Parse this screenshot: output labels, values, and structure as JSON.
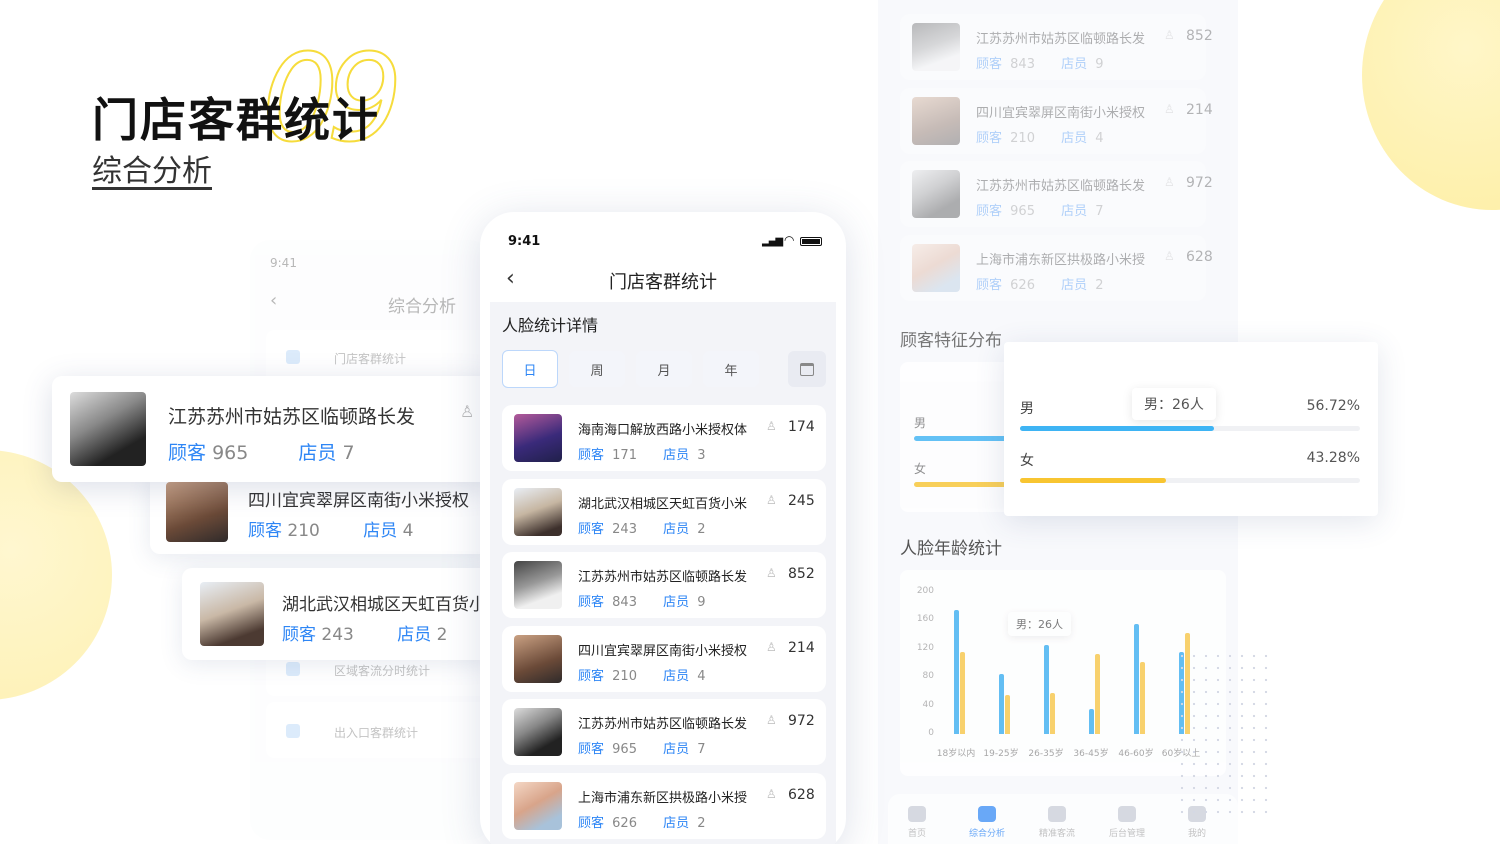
{
  "hero": {
    "title": "门店客群统计",
    "subtitle": "综合分析",
    "number": "09"
  },
  "left_phone": {
    "time": "9:41",
    "title": "综合分析",
    "menu": [
      "门店客群统计",
      "区域客流分时统计",
      "出入口客群统计"
    ]
  },
  "float_cards": [
    {
      "name": "江苏苏州市姑苏区临顿路长发",
      "customers_label": "顾客",
      "customers": "965",
      "staff_label": "店员",
      "staff": "7"
    },
    {
      "name": "四川宜宾翠屏区南街小米授权",
      "customers_label": "顾客",
      "customers": "210",
      "staff_label": "店员",
      "staff": "4"
    },
    {
      "name": "湖北武汉相城区天虹百货小",
      "customers_label": "顾客",
      "customers": "243",
      "staff_label": "店员",
      "staff": "2"
    }
  ],
  "phone": {
    "time": "9:41",
    "title": "门店客群统计",
    "section": "人脸统计详情",
    "tabs": [
      "日",
      "周",
      "月",
      "年"
    ],
    "active_tab": "日",
    "stores": [
      {
        "name": "海南海口解放西路小米授权体",
        "customers_label": "顾客",
        "customers": "171",
        "staff_label": "店员",
        "staff": "3",
        "count": "174"
      },
      {
        "name": "湖北武汉相城区天虹百货小米",
        "customers_label": "顾客",
        "customers": "243",
        "staff_label": "店员",
        "staff": "2",
        "count": "245"
      },
      {
        "name": "江苏苏州市姑苏区临顿路长发",
        "customers_label": "顾客",
        "customers": "843",
        "staff_label": "店员",
        "staff": "9",
        "count": "852"
      },
      {
        "name": "四川宜宾翠屏区南街小米授权",
        "customers_label": "顾客",
        "customers": "210",
        "staff_label": "店员",
        "staff": "4",
        "count": "214"
      },
      {
        "name": "江苏苏州市姑苏区临顿路长发",
        "customers_label": "顾客",
        "customers": "965",
        "staff_label": "店员",
        "staff": "7",
        "count": "972"
      },
      {
        "name": "上海市浦东新区拱极路小米授",
        "customers_label": "顾客",
        "customers": "626",
        "staff_label": "店员",
        "staff": "2",
        "count": "628"
      }
    ]
  },
  "right_panel": {
    "stores": [
      {
        "name": "江苏苏州市姑苏区临顿路长发",
        "customers_label": "顾客",
        "customers": "843",
        "staff_label": "店员",
        "staff": "9",
        "count": "852"
      },
      {
        "name": "四川宜宾翠屏区南街小米授权",
        "customers_label": "顾客",
        "customers": "210",
        "staff_label": "店员",
        "staff": "4",
        "count": "214"
      },
      {
        "name": "江苏苏州市姑苏区临顿路长发",
        "customers_label": "顾客",
        "customers": "965",
        "staff_label": "店员",
        "staff": "7",
        "count": "972"
      },
      {
        "name": "上海市浦东新区拱极路小米授",
        "customers_label": "顾客",
        "customers": "626",
        "staff_label": "店员",
        "staff": "2",
        "count": "628"
      }
    ],
    "feature_title": "顾客特征分布",
    "male_label": "男",
    "female_label": "女",
    "age_title": "人脸年龄统计",
    "tooltip": "男：26人",
    "nav": [
      "首页",
      "综合分析",
      "精准客流",
      "后台管理",
      "我的"
    ]
  },
  "gender_card": {
    "tooltip": "男：26人",
    "rows": [
      {
        "label": "男",
        "pct_text": "56.72%",
        "pct": 0.5672,
        "color": "#3eb4f4"
      },
      {
        "label": "女",
        "pct_text": "43.28%",
        "pct": 0.4328,
        "color": "#f8c531"
      }
    ]
  },
  "chart_data": {
    "type": "bar",
    "title": "人脸年龄统计",
    "categories": [
      "18岁以内",
      "19-25岁",
      "26-35岁",
      "36-45岁",
      "46-60岁",
      "60岁以上"
    ],
    "series": [
      {
        "color": "#4ab4f2",
        "values": [
          175,
          85,
          125,
          35,
          155,
          115
        ]
      },
      {
        "color": "#f8cb55",
        "values": [
          115,
          55,
          58,
          112,
          102,
          142
        ]
      }
    ],
    "yticks": [
      "200",
      "160",
      "120",
      "80",
      "40",
      "0"
    ],
    "ylim": [
      0,
      200
    ],
    "annotation": "男：26人"
  },
  "colors": {
    "accent": "#2e86f5",
    "yellow": "#f8c531",
    "blue_bar": "#3eb4f4"
  }
}
